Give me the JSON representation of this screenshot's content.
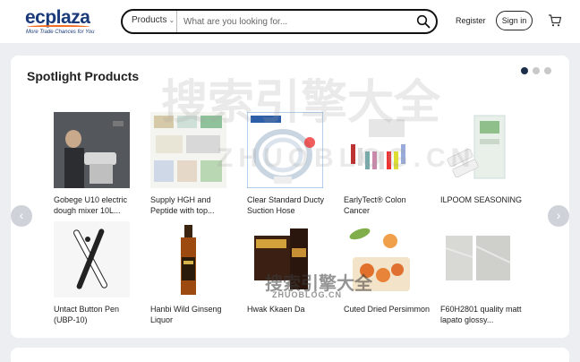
{
  "header": {
    "logo_text": "ecplaza",
    "logo_tagline": "More Trade Chances for You",
    "search": {
      "category_label": "Products",
      "placeholder": "What are you looking for...",
      "value": ""
    },
    "register_label": "Register",
    "signin_label": "Sign in"
  },
  "spotlight": {
    "title": "Spotlight Products",
    "products": [
      {
        "name": "Gobege U10 electric dough mixer 10L..."
      },
      {
        "name": "Supply HGH and Peptide with top..."
      },
      {
        "name": "Clear Standard Ducty Suction Hose"
      },
      {
        "name": "EarlyTect® Colon Cancer"
      },
      {
        "name": "ILPOOM SEASONING"
      },
      {
        "name": "Untact Button Pen (UBP-10)"
      },
      {
        "name": "Hanbi Wild Ginseng Liquor"
      },
      {
        "name": "Hwak Kkaen Da"
      },
      {
        "name": "Cuted Dried Persimmon"
      },
      {
        "name": "F60H2801 quality matt lapato glossy..."
      }
    ]
  },
  "watermark": {
    "cn_large": "搜索引擎大全",
    "url_large": "ZHUOBLOG.CN",
    "cn_small": "搜索引擎大全",
    "url_small": "ZHUOBLOG.CN"
  },
  "colors": {
    "brand_navy": "#1b3a7a",
    "brand_orange": "#f26b21",
    "active_dot": "#1c2e4a",
    "page_bg": "#eceef2"
  }
}
